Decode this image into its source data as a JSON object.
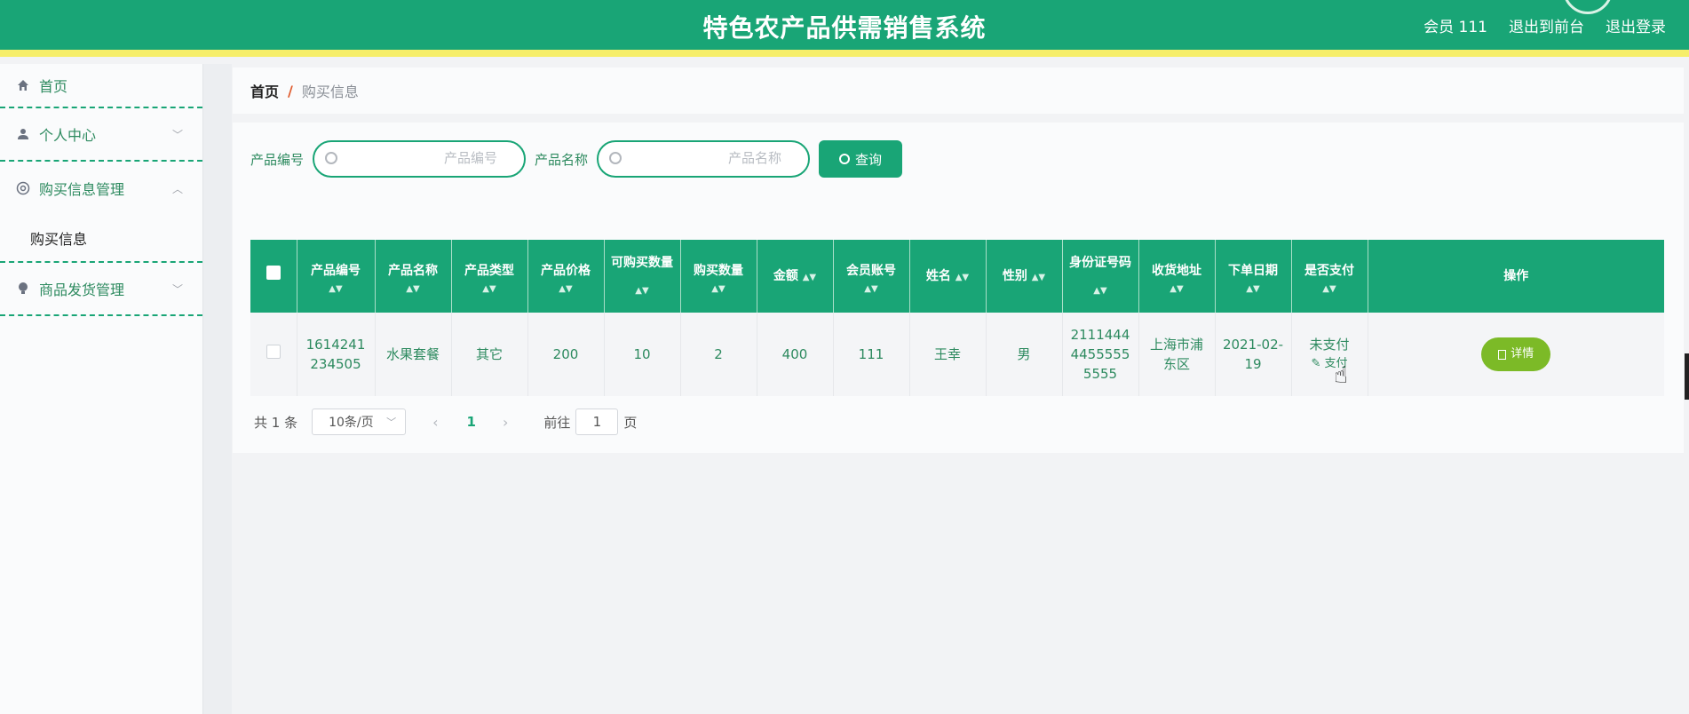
{
  "header": {
    "title": "特色农产品供需销售系统",
    "member": "会员 111",
    "to_front": "退出到前台",
    "logout": "退出登录"
  },
  "sidebar": {
    "items": [
      {
        "label": "首页",
        "icon": "home-icon"
      },
      {
        "label": "个人中心",
        "icon": "user-icon"
      },
      {
        "label": "购买信息管理",
        "icon": "settings-icon"
      },
      {
        "label": "购买信息"
      },
      {
        "label": "商品发货管理",
        "icon": "bulb-icon"
      }
    ]
  },
  "breadcrumb": {
    "home": "首页",
    "sep": "/",
    "current": "购买信息"
  },
  "search": {
    "code_label": "产品编号",
    "code_placeholder": "产品编号",
    "name_label": "产品名称",
    "name_placeholder": "产品名称",
    "button": "查询"
  },
  "table": {
    "headers": [
      "产品编号",
      "产品名称",
      "产品类型",
      "产品价格",
      "可购买数量",
      "购买数量",
      "金额",
      "会员账号",
      "姓名",
      "性别",
      "身份证号码",
      "收货地址",
      "下单日期",
      "是否支付",
      "操作"
    ],
    "rows": [
      {
        "code": "1614241234505",
        "name": "水果套餐",
        "type": "其它",
        "price": "200",
        "available": "10",
        "qty": "2",
        "amount": "400",
        "account": "111",
        "person": "王幸",
        "gender": "男",
        "id_card": "211144444555555555",
        "address": "上海市浦东区",
        "date": "2021-02-19",
        "paid_status": "未支付",
        "pay_action": "支付",
        "detail": "详情"
      }
    ]
  },
  "pagination": {
    "total": "共 1 条",
    "page_size": "10条/页",
    "current": "1",
    "goto_label": "前往",
    "goto_value": "1",
    "page_suffix": "页"
  },
  "colors": {
    "primary": "#19a576",
    "accent_strip": "#f6ee6a",
    "detail_button": "#7cba27"
  }
}
